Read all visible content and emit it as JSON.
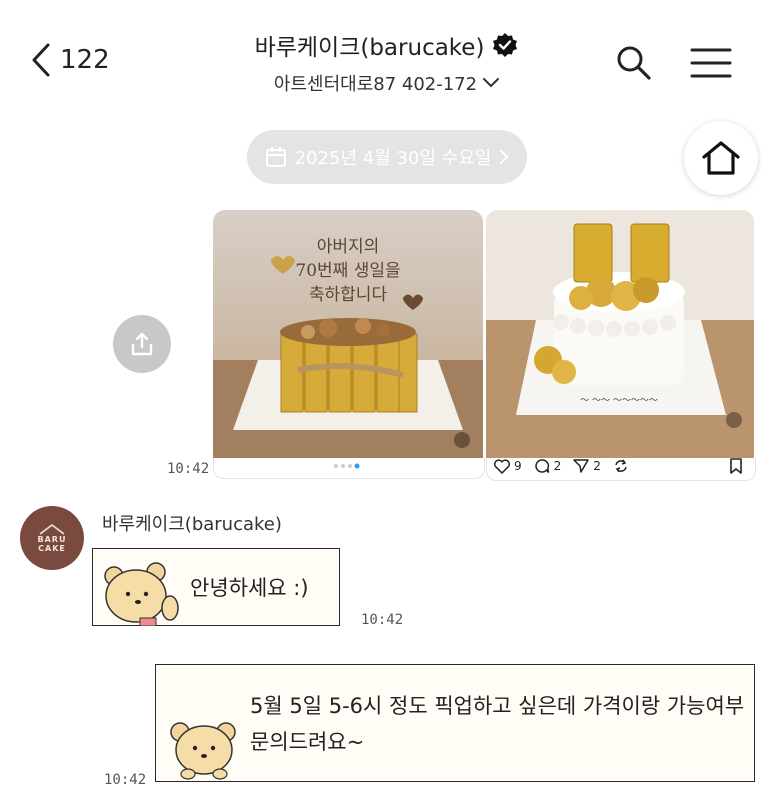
{
  "header": {
    "back_count": "122",
    "title": "바루케이크(barucake)",
    "subtitle": "아트센터대로87 402-172"
  },
  "date_divider": "2025년 4월 30일 수요일",
  "post": {
    "image1_overlay": "아버지의 70번째 생일을 축하합니다",
    "time": "10:42",
    "stats": {
      "likes": "9",
      "comments": "2",
      "shares": "2"
    }
  },
  "sender": {
    "name": "바루케이크(barucake)",
    "avatar_line1": "BARU",
    "avatar_line2": "CAKE"
  },
  "messages": [
    {
      "text": "안녕하세요 :)",
      "time": "10:42"
    },
    {
      "text": "5월 5일 5-6시 정도 픽업하고 싶은데 가격이랑 가능여부 문의드려요~",
      "time": "10:42"
    }
  ],
  "colors": {
    "verified": "#111111",
    "pill": "#e4e4e4",
    "avatar": "#7b4a3e",
    "bubble_bg": "#fffdf5"
  },
  "icons": [
    "chevron-left-icon",
    "verified-icon",
    "chevron-down-icon",
    "search-icon",
    "menu-icon",
    "calendar-icon",
    "chevron-right-icon",
    "home-icon",
    "share-icon",
    "heart-icon",
    "comment-icon",
    "send-icon",
    "repost-icon",
    "bookmark-icon",
    "mute-icon",
    "bear-sticker-icon"
  ]
}
